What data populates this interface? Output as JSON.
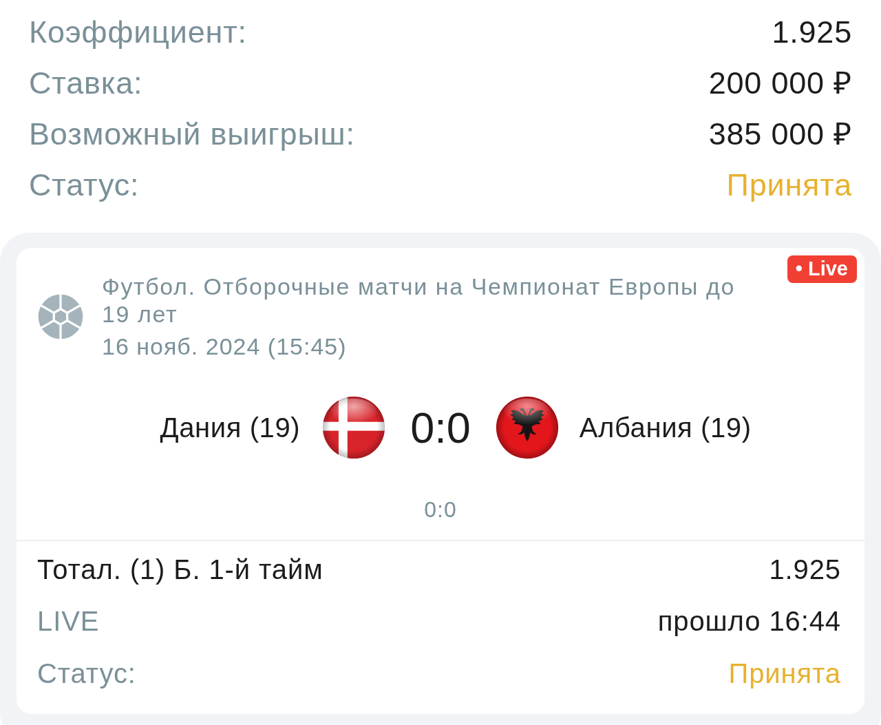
{
  "summary": [
    {
      "kind": "plain",
      "label": "Коэффициент:",
      "value": "1.925"
    },
    {
      "kind": "plain",
      "label": "Ставка:",
      "value": "200 000 ₽"
    },
    {
      "kind": "plain",
      "label": "Возможный выигрыш:",
      "value": "385 000 ₽"
    },
    {
      "kind": "status",
      "label": "Статус:",
      "value": "Принята"
    }
  ],
  "event": {
    "badge": "• Live",
    "title": "Футбол. Отборочные матчи на Чемпионат Европы до 19 лет",
    "date": "16 нояб. 2024 (15:45)",
    "home": {
      "name": "Дания (19)",
      "kind": "cross"
    },
    "score": "0:0",
    "away": {
      "name": "Албания (19)",
      "kind": "eagle"
    },
    "subscore": "0:0"
  },
  "bet_rows": [
    {
      "kind": "market",
      "label": "Тотал. (1) Б. 1-й тайм",
      "value": "1.925"
    },
    {
      "kind": "plain",
      "label": "LIVE",
      "value": "прошло 16:44"
    },
    {
      "kind": "status",
      "label": "Статус:",
      "value": "Принята"
    }
  ]
}
